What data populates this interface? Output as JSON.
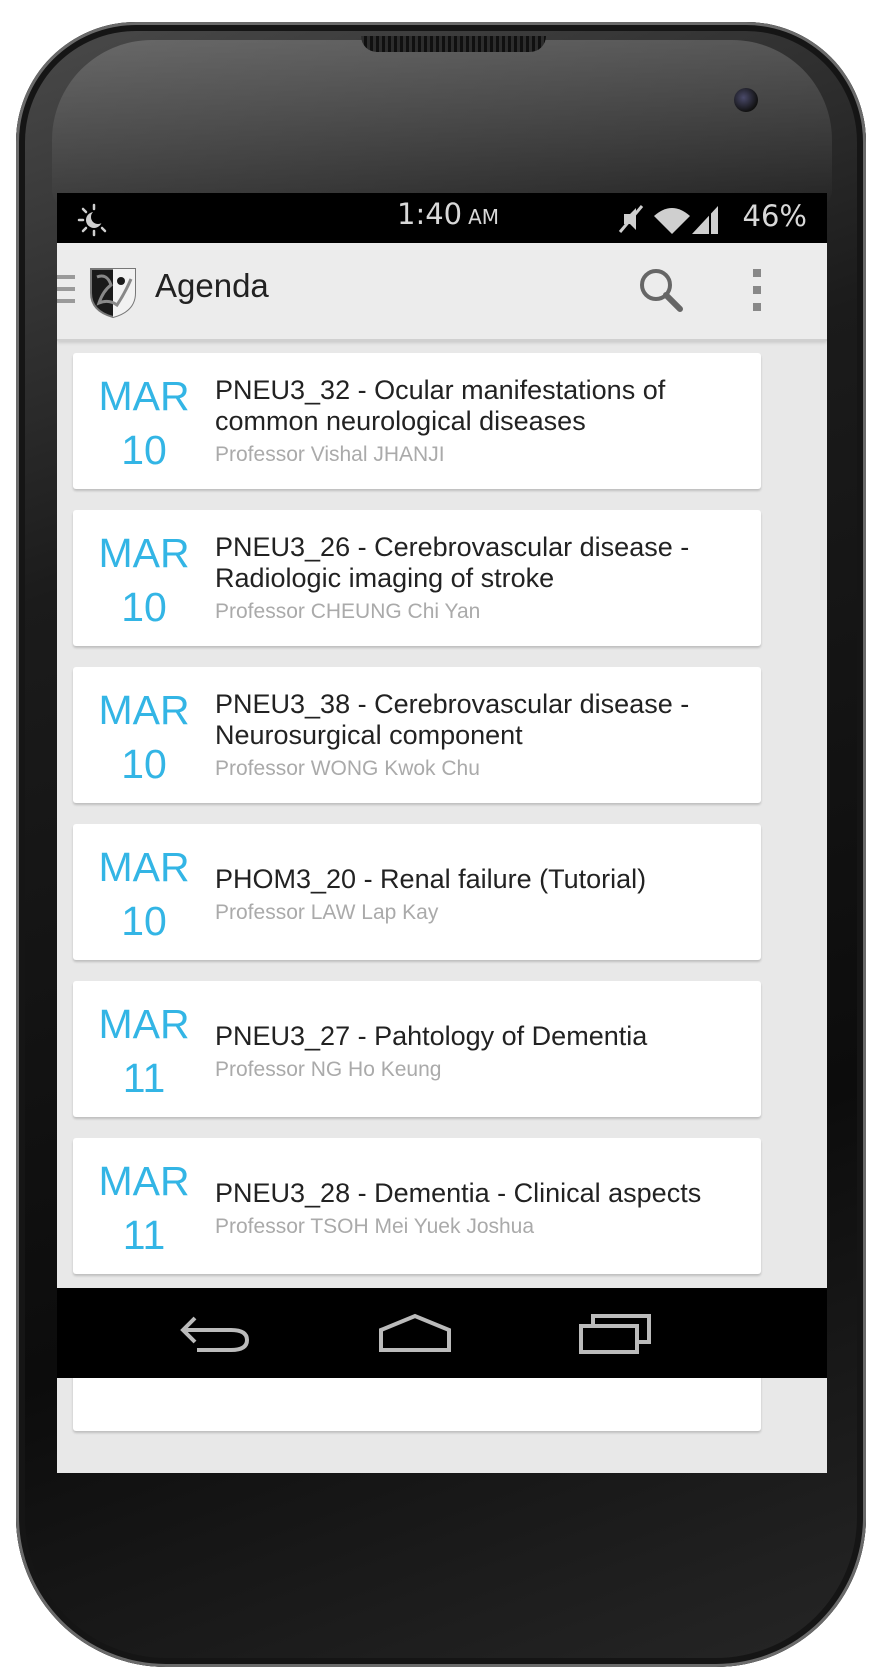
{
  "status_bar": {
    "time": "1:40",
    "time_suffix": "AM",
    "battery": "46%",
    "icons": [
      "weather-icon",
      "mute-icon",
      "wifi-icon",
      "signal-icon"
    ]
  },
  "action_bar": {
    "title": "Agenda",
    "icons": [
      "drawer-icon",
      "app-logo-icon",
      "search-icon",
      "overflow-menu-icon"
    ]
  },
  "agenda": [
    {
      "month": "MAR",
      "day": "10",
      "title": "PNEU3_32 - Ocular manifestations of common neurological diseases",
      "presenter": "Professor Vishal JHANJI"
    },
    {
      "month": "MAR",
      "day": "10",
      "title": "PNEU3_26 - Cerebrovascular disease - Radiologic imaging of stroke",
      "presenter": "Professor CHEUNG Chi Yan"
    },
    {
      "month": "MAR",
      "day": "10",
      "title": "PNEU3_38 - Cerebrovascular disease - Neurosurgical component",
      "presenter": "Professor WONG Kwok Chu"
    },
    {
      "month": "MAR",
      "day": "10",
      "title": "PHOM3_20 - Renal failure (Tutorial)",
      "presenter": "Professor LAW Lap Kay"
    },
    {
      "month": "MAR",
      "day": "11",
      "title": "PNEU3_27 - Pahtology of Dementia",
      "presenter": "Professor NG Ho Keung"
    },
    {
      "month": "MAR",
      "day": "11",
      "title": "PNEU3_28 - Dementia - Clinical aspects",
      "presenter": "Professor TSOH Mei Yuek Joshua"
    }
  ],
  "nav_bar": {
    "icons": [
      "back-icon",
      "home-icon",
      "recent-apps-icon"
    ]
  },
  "colors": {
    "accent": "#33b5e5",
    "subtitle": "#aaaaaa",
    "background": "#e8e8e8"
  }
}
